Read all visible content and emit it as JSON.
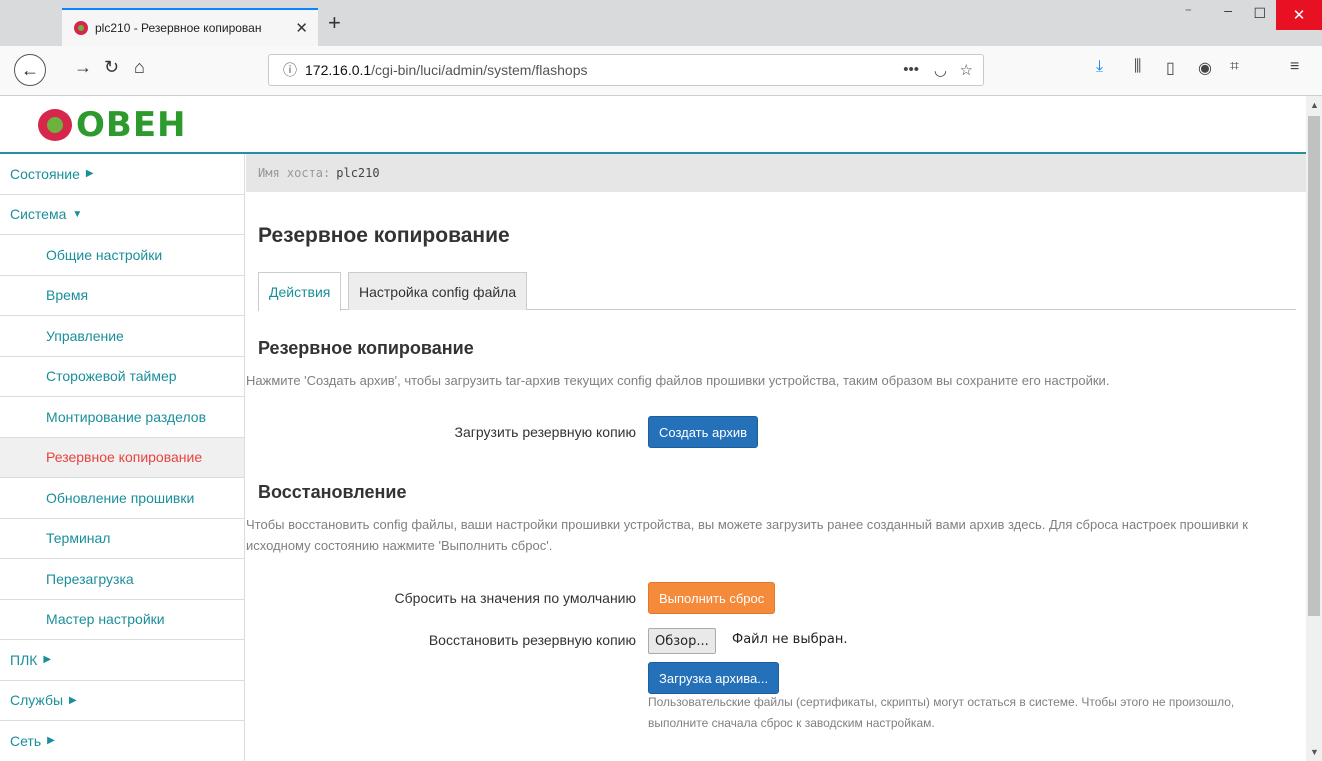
{
  "browser": {
    "tab_title": "plc210 - Резервное копирован",
    "new_tab_symbol": "+",
    "url_host": "172.16.0.1",
    "url_path": "/cgi-bin/luci/admin/system/flashops"
  },
  "header": {
    "logo_text": "ОВЕН"
  },
  "sidebar": {
    "items": [
      {
        "label": "Состояние",
        "caret": "▶"
      },
      {
        "label": "Система",
        "caret": "▼"
      },
      {
        "label": "Общие настройки"
      },
      {
        "label": "Время"
      },
      {
        "label": "Управление"
      },
      {
        "label": "Сторожевой таймер"
      },
      {
        "label": "Монтирование разделов"
      },
      {
        "label": "Резервное копирование"
      },
      {
        "label": "Обновление прошивки"
      },
      {
        "label": "Терминал"
      },
      {
        "label": "Перезагрузка"
      },
      {
        "label": "Мастер настройки"
      },
      {
        "label": "ПЛК",
        "caret": "▶"
      },
      {
        "label": "Службы",
        "caret": "▶"
      },
      {
        "label": "Сеть",
        "caret": "▶"
      }
    ]
  },
  "hostbar": {
    "label": "Имя хоста:",
    "value": "plc210"
  },
  "main": {
    "title": "Резервное копирование",
    "tabs": [
      {
        "label": "Действия"
      },
      {
        "label": "Настройка config файла"
      }
    ],
    "backup": {
      "heading": "Резервное копирование",
      "description": "Нажмите 'Создать архив', чтобы загрузить tar-архив текущих config файлов прошивки устройства, таким образом вы сохраните его настройки.",
      "download_label": "Загрузить резервную копию",
      "create_button": "Создать архив"
    },
    "restore": {
      "heading": "Восстановление",
      "description": "Чтобы восстановить config файлы, ваши настройки прошивки устройства, вы можете загрузить ранее созданный вами архив здесь. Для сброса настроек прошивки к исходному состоянию нажмите 'Выполнить сброс'.",
      "reset_label": "Сбросить на значения по умолчанию",
      "reset_button": "Выполнить сброс",
      "restore_label": "Восстановить резервную копию",
      "browse_button": "Обзор...",
      "no_file": "Файл не выбран.",
      "upload_button": "Загрузка архива...",
      "note": "Пользовательские файлы (сертификаты, скрипты) могут остаться в системе. Чтобы этого не произошло, выполните сначала сброс к заводским настройкам."
    }
  },
  "colors": {
    "accent": "#1a8f9b",
    "active": "#e8433f",
    "primary_button": "#2571b9",
    "danger_button": "#f58a3a"
  }
}
